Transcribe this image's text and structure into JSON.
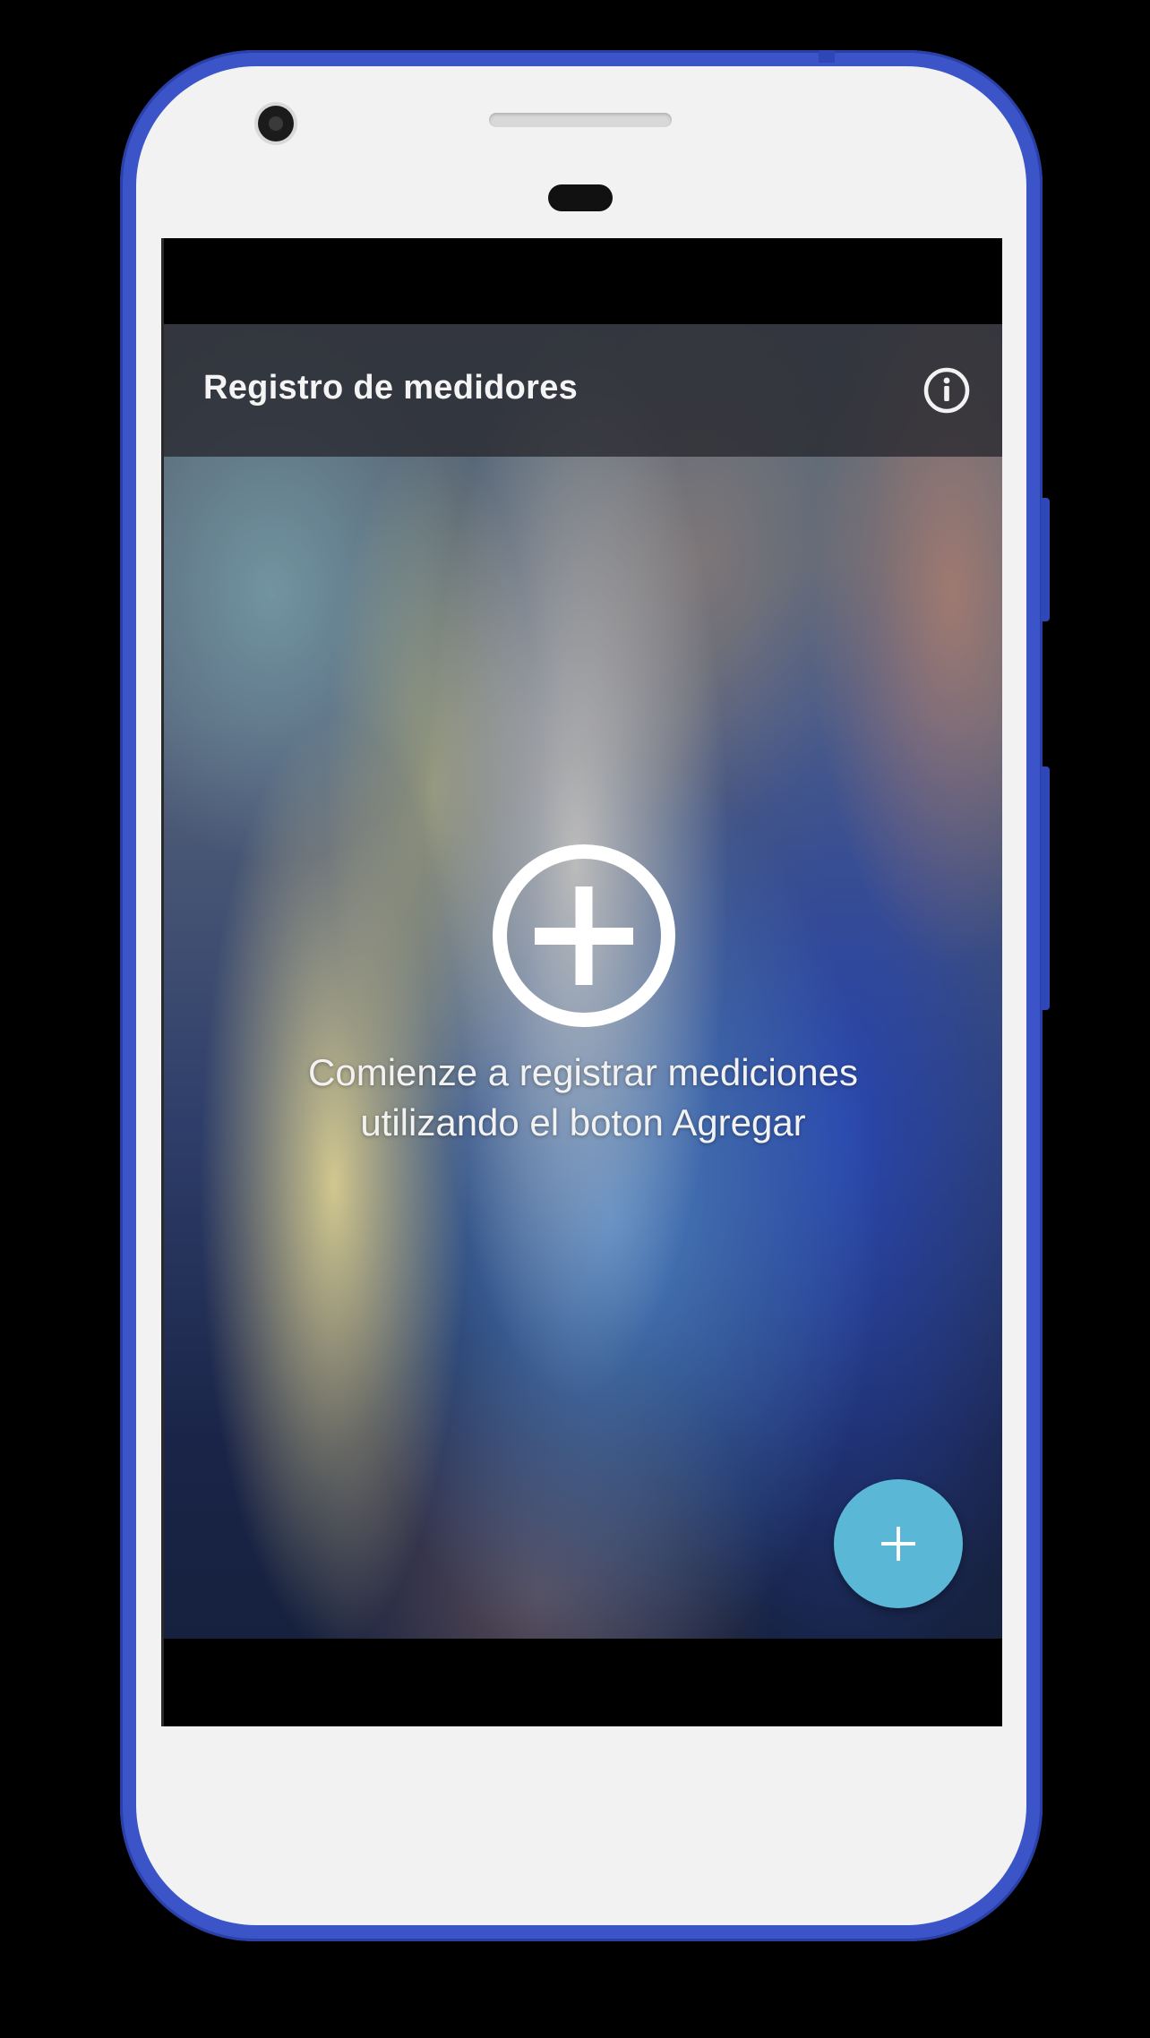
{
  "app": {
    "title": "Registro de medidores"
  },
  "toolbar": {
    "info_icon": "info-icon"
  },
  "empty_state": {
    "icon": "add-circle-icon",
    "line1": "Comienze a registrar mediciones",
    "line2": "utilizando el boton Agregar"
  },
  "fab": {
    "icon": "plus-icon"
  },
  "colors": {
    "frame": "#3b55c9",
    "fab": "#5ab8d6",
    "app_bar": "#28282e"
  }
}
